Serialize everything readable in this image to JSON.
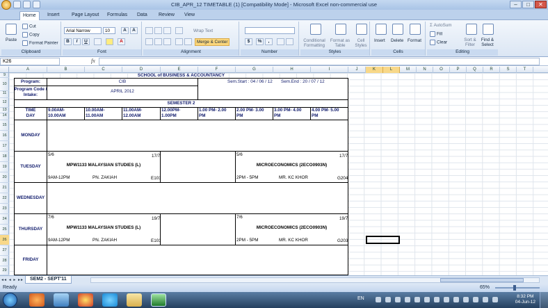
{
  "window": {
    "title": "CIB_APR_12 TIMETABLE (1)  [Compatibility Mode] - Microsoft Excel non-commercial use"
  },
  "tabs": [
    "Home",
    "Insert",
    "Page Layout",
    "Formulas",
    "Data",
    "Review",
    "View"
  ],
  "ribbon": {
    "clipboard": {
      "label": "Clipboard",
      "paste": "Paste",
      "cut": "Cut",
      "copy": "Copy",
      "format_painter": "Format Painter"
    },
    "font": {
      "label": "Font",
      "name": "Arial Narrow",
      "size": "10",
      "bold": "B",
      "italic": "I",
      "underline": "U"
    },
    "alignment": {
      "label": "Alignment",
      "wrap": "Wrap Text",
      "merge": "Merge & Center"
    },
    "number": {
      "label": "Number",
      "currency": "$",
      "percent": "%",
      "comma": ","
    },
    "styles": {
      "label": "Styles",
      "conditional": "Conditional Formatting",
      "table": "Format as Table",
      "cell": "Cell Styles"
    },
    "cells": {
      "label": "Cells",
      "insert": "Insert",
      "delete": "Delete",
      "format": "Format"
    },
    "editing": {
      "label": "Editing",
      "autosum": "AutoSum",
      "fill": "Fill",
      "clear": "Clear",
      "sort": "Sort & Filter",
      "find": "Find & Select"
    }
  },
  "formula_bar": {
    "name_box": "K26",
    "fx": "fx",
    "value": ""
  },
  "columns": [
    "A",
    "B",
    "C",
    "D",
    "E",
    "F",
    "G",
    "H",
    "I",
    "J",
    "K",
    "L",
    "M",
    "N",
    "O",
    "P",
    "Q",
    "R",
    "S",
    "T"
  ],
  "rows": [
    "9",
    "10",
    "11",
    "12",
    "13",
    "14",
    "15",
    "16",
    "17",
    "18",
    "19",
    "20",
    "21",
    "22",
    "23",
    "24",
    "25",
    "26",
    "27",
    "28",
    "29"
  ],
  "timetable": {
    "school": "SCHOOL of BUSINESS & ACCOUNTANCY",
    "program_label": "Program:",
    "program": "CIB",
    "sem_start": "Sem.Start : 04 / 06 / 12",
    "sem_end": "Sem.End : 20 / 07 / 12",
    "code_label": "Program Code / Intake:",
    "intake": "APRIL 2012",
    "semester": "SEMESTER 2",
    "time_label": "TIME",
    "day_label": "DAY",
    "slots": [
      "9.00AM- 10.00AM",
      "10.00AM- 11.00AM",
      "11.00AM- 12.00AM",
      "12.00PM- 1.00PM",
      "1.00 PM- 2.00 PM",
      "2.00 PM- 3.00 PM",
      "3.00 PM- 4.00 PM",
      "4.00 PM- 5.00 PM"
    ],
    "days": [
      "MONDAY",
      "TUESDAY",
      "WEDNESDAY",
      "THURSDAY",
      "FRIDAY"
    ],
    "tue_a": {
      "start": "5/6",
      "end": "17/7",
      "course": "MPW1133 MALAYSIAN STUDIES (L)",
      "time": "9AM-12PM",
      "lecturer": "PN. ZAKIAH",
      "room": "E101"
    },
    "tue_b": {
      "start": "5/6",
      "end": "17/7",
      "course": "MICROECONOMICS (2ECO0903N)",
      "time": "2PM - 5PM",
      "lecturer": "MR. KC KHOR",
      "room": "G204"
    },
    "thu_a": {
      "start": "7/6",
      "end": "19/7",
      "course": "MPW1133 MALAYSIAN STUDIES (L)",
      "time": "9AM-12PM",
      "lecturer": "PN. ZAKIAH",
      "room": "E101"
    },
    "thu_b": {
      "start": "7/6",
      "end": "19/7",
      "course": "MICROECONOMICS (2ECO0903N)",
      "time": "2PM - 5PM",
      "lecturer": "MR. KC KHOR",
      "room": "G203"
    }
  },
  "sheet_tab": "SEM2 - SEPT'11",
  "status": {
    "ready": "Ready",
    "zoom": "65%"
  },
  "taskbar": {
    "lang": "EN",
    "time": "8:32 PM",
    "date": "04-Jun-12"
  }
}
